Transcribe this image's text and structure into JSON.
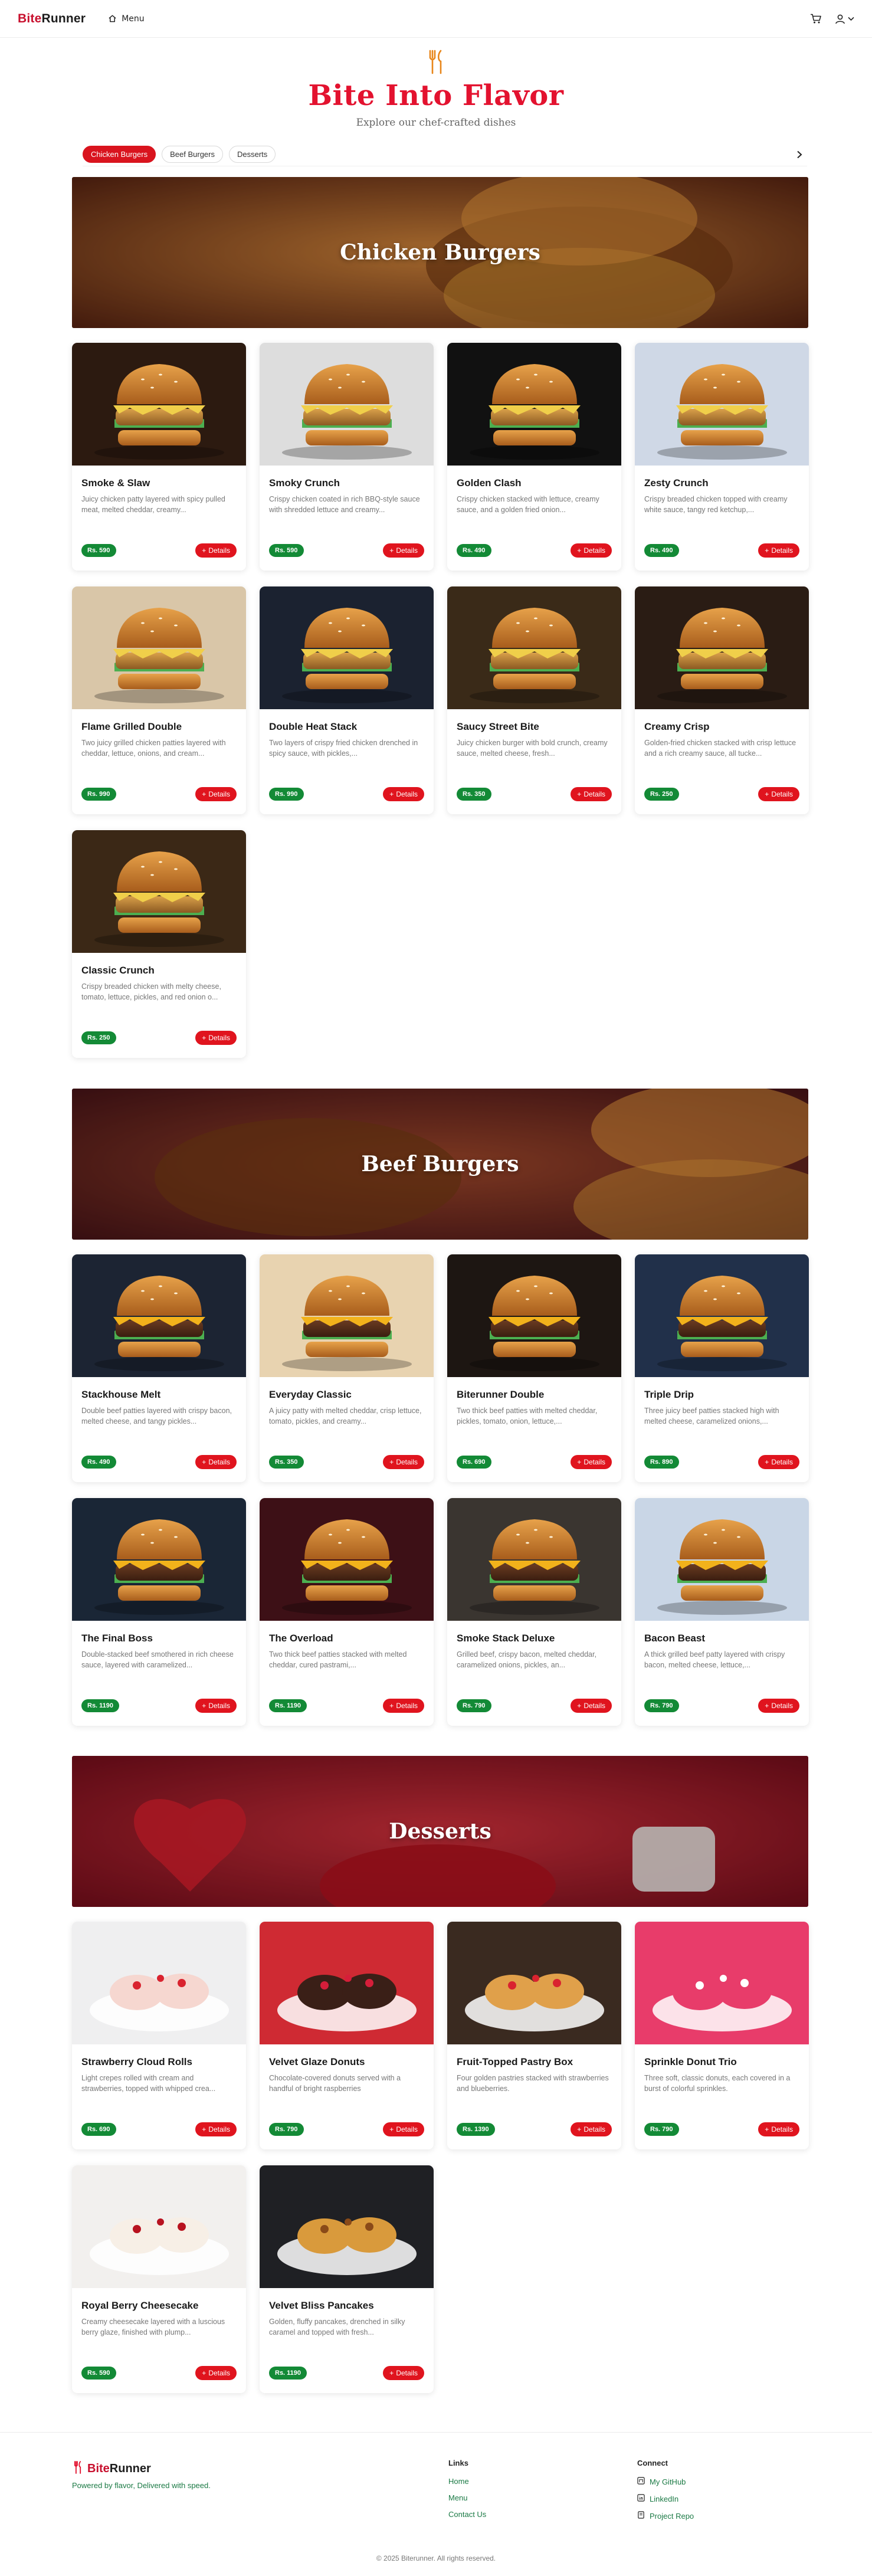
{
  "navbar": {
    "brand_part1": "Bite",
    "brand_part2": "Runner",
    "menu_label": "Menu",
    "icons": [
      "home-icon",
      "cart-icon",
      "user-icon",
      "chevron-down-icon"
    ]
  },
  "hero": {
    "title": "Bite Into Flavor",
    "subtitle": "Explore our chef-crafted dishes",
    "icon": "fork-knife-icon"
  },
  "tabs": {
    "items": [
      {
        "label": "Chicken Burgers",
        "active": true
      },
      {
        "label": "Beef Burgers",
        "active": false
      },
      {
        "label": "Desserts",
        "active": false
      }
    ]
  },
  "colors": {
    "brand_red": "#e3122f",
    "price_green": "#138a36",
    "details_red": "#e0141e"
  },
  "details_label": "Details",
  "sections": [
    {
      "title": "Chicken Burgers",
      "items": [
        {
          "name": "Smoke & Slaw",
          "desc": "Juicy chicken patty layered with spicy pulled meat, melted cheddar, creamy...",
          "price": "Rs. 590"
        },
        {
          "name": "Smoky Crunch",
          "desc": "Crispy chicken coated in rich BBQ-style sauce with shredded lettuce and creamy...",
          "price": "Rs. 590"
        },
        {
          "name": "Golden Clash",
          "desc": "Crispy chicken stacked with lettuce, creamy sauce, and a golden fried onion...",
          "price": "Rs. 490"
        },
        {
          "name": "Zesty Crunch",
          "desc": "Crispy breaded chicken topped with creamy white sauce, tangy red ketchup,...",
          "price": "Rs. 490"
        },
        {
          "name": "Flame Grilled Double",
          "desc": "Two juicy grilled chicken patties layered with cheddar, lettuce, onions, and cream...",
          "price": "Rs. 990"
        },
        {
          "name": "Double Heat Stack",
          "desc": "Two layers of crispy fried chicken drenched in spicy sauce, with pickles,...",
          "price": "Rs. 990"
        },
        {
          "name": "Saucy Street Bite",
          "desc": "Juicy chicken burger with bold crunch, creamy sauce, melted cheese, fresh...",
          "price": "Rs. 350"
        },
        {
          "name": "Creamy Crisp",
          "desc": "Golden-fried chicken stacked with crisp lettuce and a rich creamy sauce, all tucke...",
          "price": "Rs. 250"
        },
        {
          "name": "Classic Crunch",
          "desc": "Crispy breaded chicken with melty cheese, tomato, lettuce, pickles, and red onion o...",
          "price": "Rs. 250"
        }
      ]
    },
    {
      "title": "Beef Burgers",
      "items": [
        {
          "name": "Stackhouse Melt",
          "desc": "Double beef patties layered with crispy bacon, melted cheese, and tangy pickles...",
          "price": "Rs. 490"
        },
        {
          "name": "Everyday Classic",
          "desc": "A juicy patty with melted cheddar, crisp lettuce, tomato, pickles, and creamy...",
          "price": "Rs. 350"
        },
        {
          "name": "Biterunner Double",
          "desc": "Two thick beef patties with melted cheddar, pickles, tomato, onion, lettuce,...",
          "price": "Rs. 690"
        },
        {
          "name": "Triple Drip",
          "desc": "Three juicy beef patties stacked high with melted cheese, caramelized onions,...",
          "price": "Rs. 890"
        },
        {
          "name": "The Final Boss",
          "desc": "Double-stacked beef smothered in rich cheese sauce, layered with caramelized...",
          "price": "Rs. 1190"
        },
        {
          "name": "The Overload",
          "desc": "Two thick beef patties stacked with melted cheddar, cured pastrami,...",
          "price": "Rs. 1190"
        },
        {
          "name": "Smoke Stack Deluxe",
          "desc": "Grilled beef, crispy bacon, melted cheddar, caramelized onions, pickles, an...",
          "price": "Rs. 790"
        },
        {
          "name": "Bacon Beast",
          "desc": "A thick grilled beef patty layered with crispy bacon, melted cheese, lettuce,...",
          "price": "Rs. 790"
        }
      ]
    },
    {
      "title": "Desserts",
      "items": [
        {
          "name": "Strawberry Cloud Rolls",
          "desc": "Light crepes rolled with cream and strawberries, topped with whipped crea...",
          "price": "Rs. 690"
        },
        {
          "name": "Velvet Glaze Donuts",
          "desc": "Chocolate-covered donuts served with a handful of bright raspberries",
          "price": "Rs. 790"
        },
        {
          "name": "Fruit-Topped Pastry Box",
          "desc": "Four golden pastries stacked with strawberries and blueberries.",
          "price": "Rs. 1390"
        },
        {
          "name": "Sprinkle Donut Trio",
          "desc": "Three soft, classic donuts, each covered in a burst of colorful sprinkles.",
          "price": "Rs. 790"
        },
        {
          "name": "Royal Berry Cheesecake",
          "desc": "Creamy cheesecake layered with a luscious berry glaze, finished with plump...",
          "price": "Rs. 590"
        },
        {
          "name": "Velvet Bliss Pancakes",
          "desc": "Golden, fluffy pancakes, drenched in silky caramel and topped with fresh...",
          "price": "Rs. 1190"
        }
      ]
    }
  ],
  "footer": {
    "brand_part1": "Bite",
    "brand_part2": "Runner",
    "tagline": "Powered by flavor, Delivered with speed.",
    "links_heading": "Links",
    "links": [
      "Home",
      "Menu",
      "Contact Us"
    ],
    "connect_heading": "Connect",
    "connect": [
      {
        "label": "My GitHub",
        "icon": "github-icon"
      },
      {
        "label": "LinkedIn",
        "icon": "linkedin-icon"
      },
      {
        "label": "Project Repo",
        "icon": "repo-icon"
      }
    ],
    "copyright": "© 2025 Biterunner. All rights reserved."
  }
}
